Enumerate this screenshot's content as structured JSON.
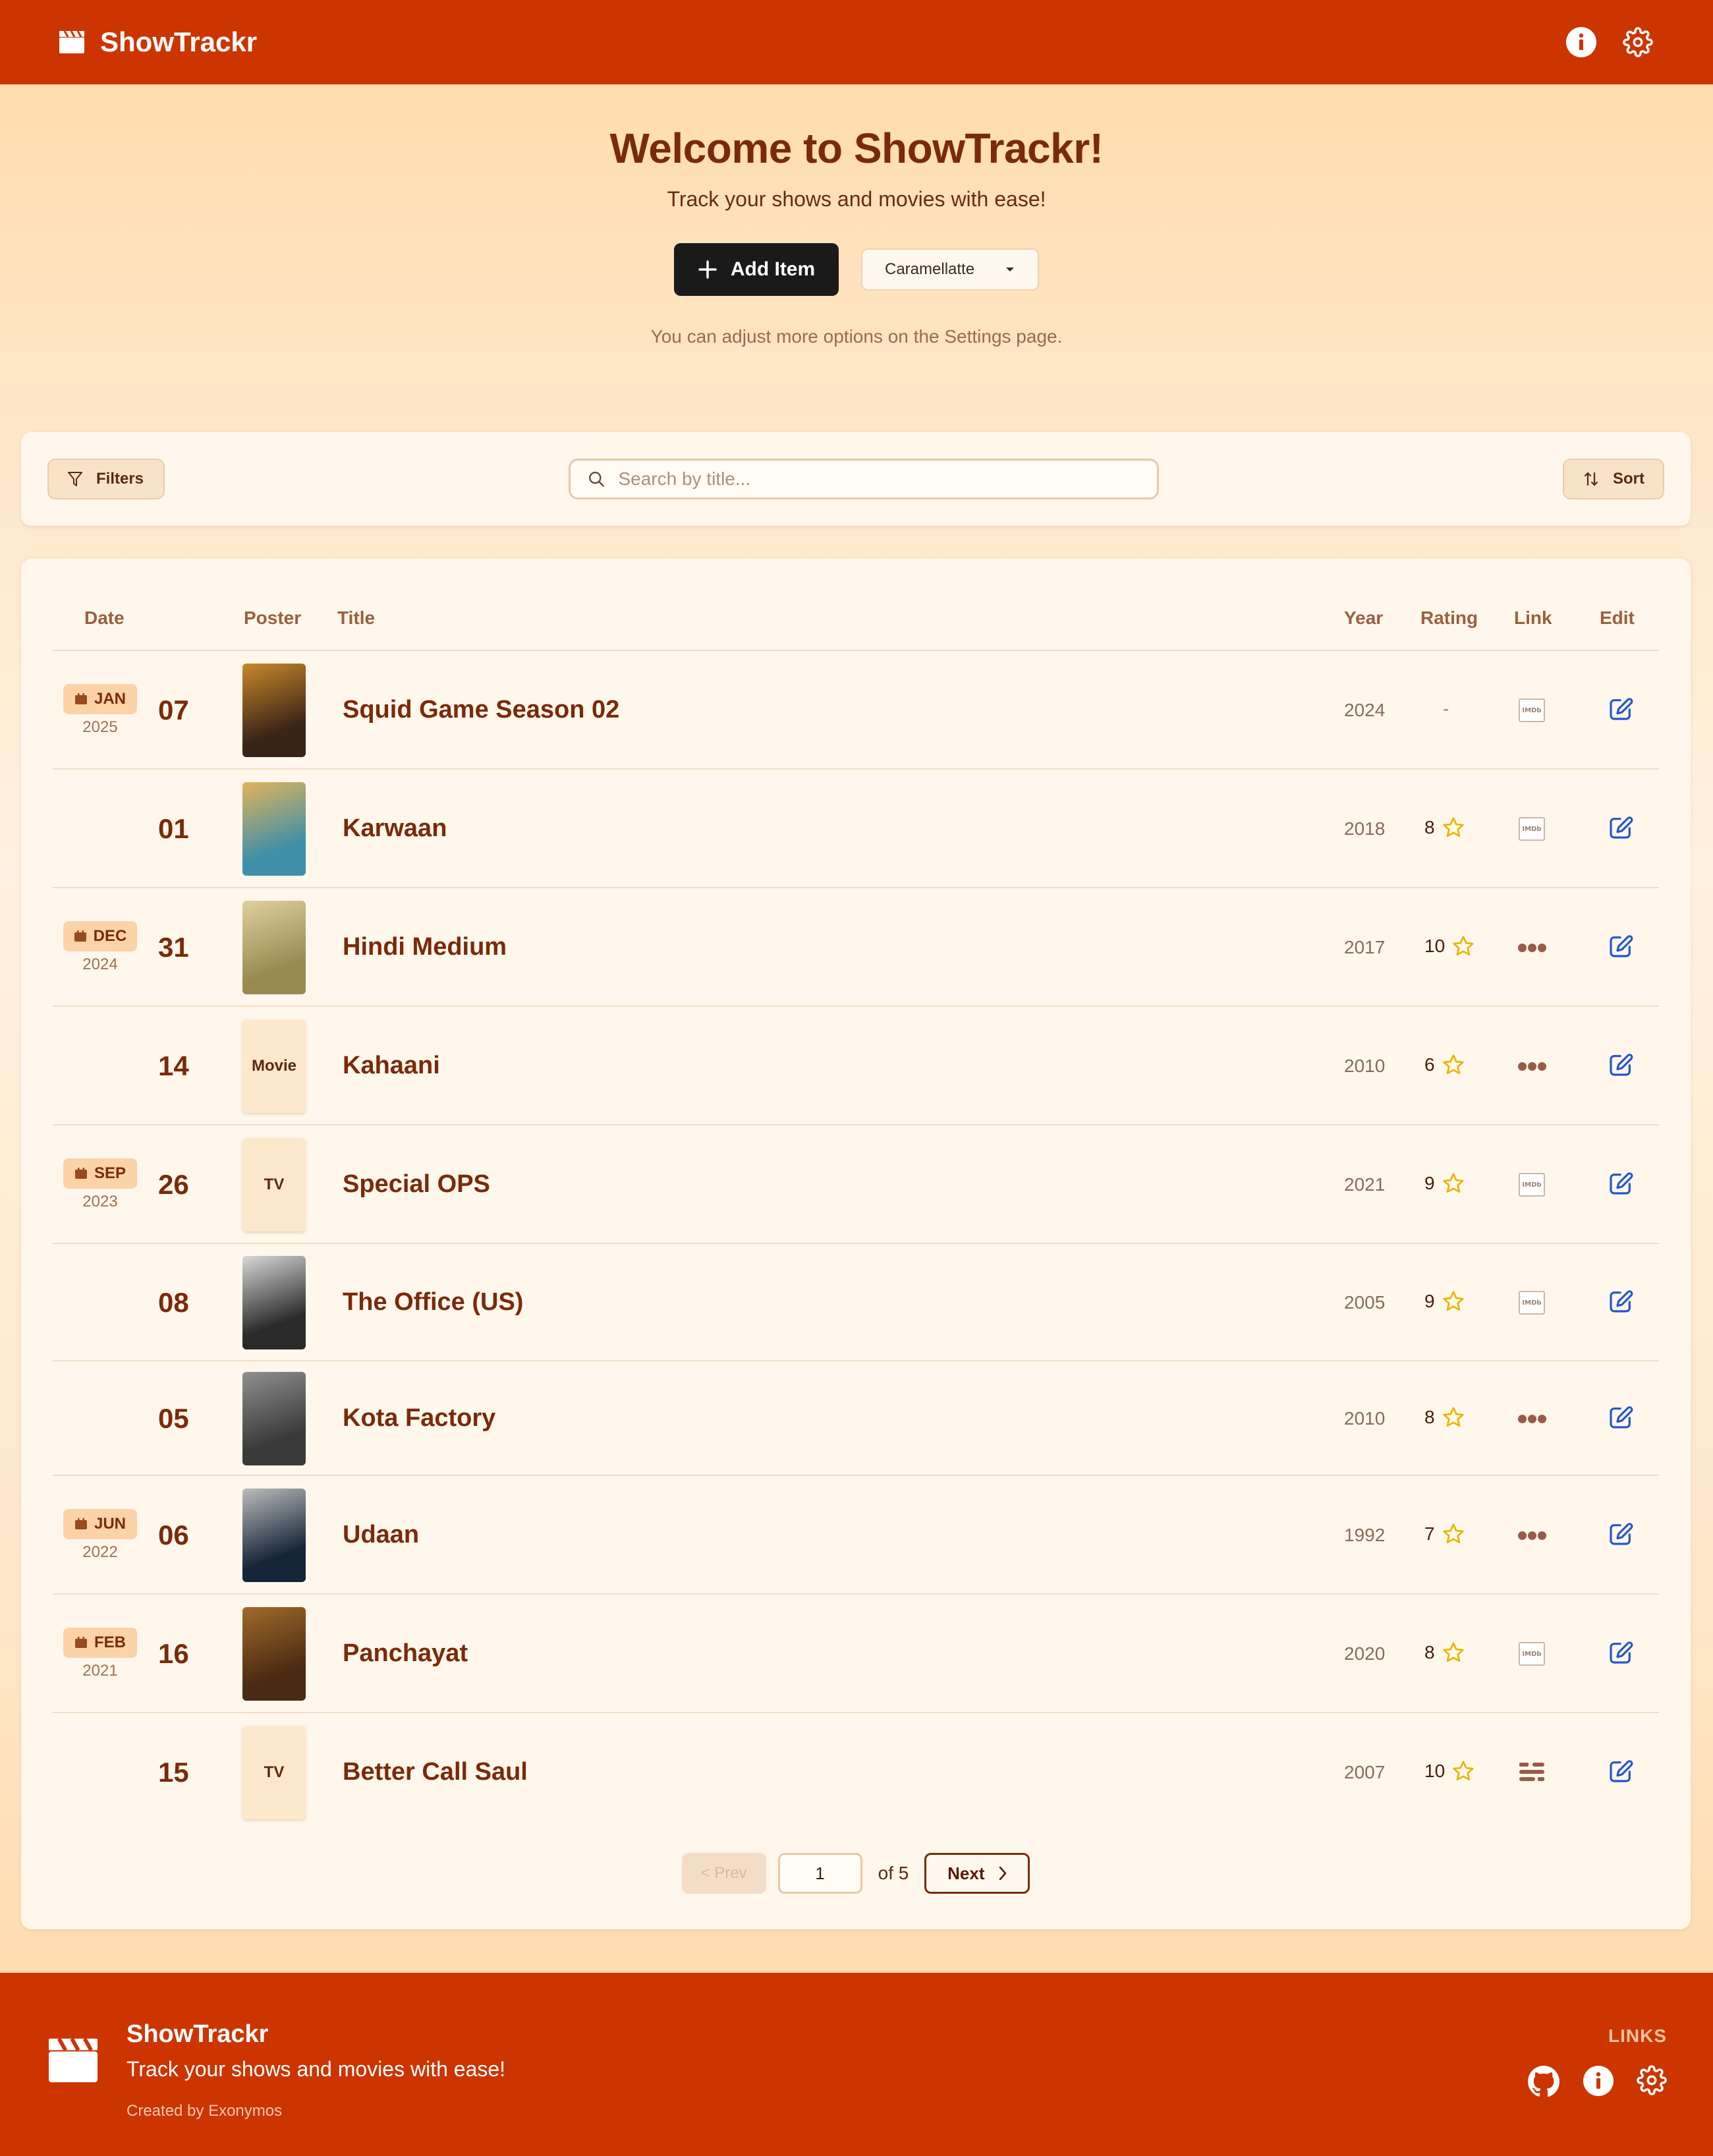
{
  "header": {
    "app_name": "ShowTrackr",
    "icons": [
      "clapperboard-icon",
      "info-icon",
      "settings-icon"
    ]
  },
  "hero": {
    "title": "Welcome to ShowTrackr!",
    "subtitle": "Track your shows and movies with ease!",
    "add_button_label": "Add Item",
    "theme_selected": "Caramellatte",
    "note": "You can adjust more options on the Settings page."
  },
  "toolbar": {
    "filters_label": "Filters",
    "search_placeholder": "Search by title...",
    "sort_label": "Sort"
  },
  "table": {
    "columns": {
      "date": "Date",
      "poster": "Poster",
      "title": "Title",
      "year": "Year",
      "rating": "Rating",
      "link": "Link",
      "edit": "Edit"
    },
    "rows": [
      {
        "month": "JAN",
        "year_label": "2025",
        "day": "07",
        "title": "Squid Game Season 02",
        "year": "2024",
        "rating": "-",
        "poster": "image",
        "link": "imdb"
      },
      {
        "month": "",
        "year_label": "",
        "day": "01",
        "title": "Karwaan",
        "year": "2018",
        "rating": "8",
        "poster": "image",
        "link": "imdb"
      },
      {
        "month": "DEC",
        "year_label": "2024",
        "day": "31",
        "title": "Hindi Medium",
        "year": "2017",
        "rating": "10",
        "poster": "image",
        "link": "other"
      },
      {
        "month": "",
        "year_label": "",
        "day": "14",
        "title": "Kahaani",
        "year": "2010",
        "rating": "6",
        "poster": "Movie",
        "link": "other"
      },
      {
        "month": "SEP",
        "year_label": "2023",
        "day": "26",
        "title": "Special OPS",
        "year": "2021",
        "rating": "9",
        "poster": "TV",
        "link": "imdb"
      },
      {
        "month": "",
        "year_label": "",
        "day": "08",
        "title": "The Office (US)",
        "year": "2005",
        "rating": "9",
        "poster": "image",
        "link": "imdb"
      },
      {
        "month": "",
        "year_label": "",
        "day": "05",
        "title": "Kota Factory",
        "year": "2010",
        "rating": "8",
        "poster": "image",
        "link": "other"
      },
      {
        "month": "JUN",
        "year_label": "2022",
        "day": "06",
        "title": "Udaan",
        "year": "1992",
        "rating": "7",
        "poster": "image",
        "link": "other"
      },
      {
        "month": "FEB",
        "year_label": "2021",
        "day": "16",
        "title": "Panchayat",
        "year": "2020",
        "rating": "8",
        "poster": "image",
        "link": "imdb"
      },
      {
        "month": "",
        "year_label": "",
        "day": "15",
        "title": "Better Call Saul",
        "year": "2007",
        "rating": "10",
        "poster": "TV",
        "link": "tmdb"
      }
    ]
  },
  "pagination": {
    "prev_label": "< Prev",
    "current_page": "1",
    "of_label": "of 5",
    "next_label": "Next"
  },
  "footer": {
    "app_name": "ShowTrackr",
    "tagline": "Track your shows and movies with ease!",
    "credit": "Created by Exonymos",
    "links_label": "LINKS",
    "icons": [
      "github-icon",
      "info-icon",
      "settings-icon"
    ]
  },
  "colors": {
    "brand": "#cc3500",
    "text": "#7a2a0a",
    "star": "#e8b600",
    "edit": "#2255cc"
  }
}
